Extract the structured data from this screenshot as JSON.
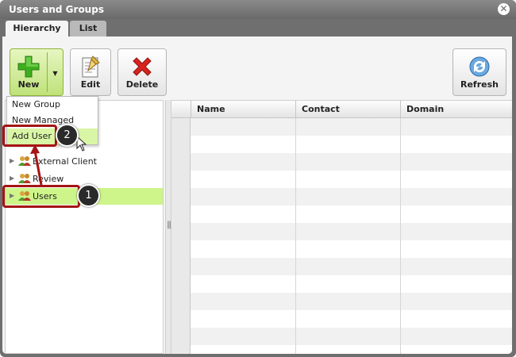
{
  "window": {
    "title": "Users and Groups",
    "close_glyph": "✕"
  },
  "tabs": [
    {
      "label": "Hierarchy",
      "active": true
    },
    {
      "label": "List",
      "active": false
    }
  ],
  "toolbar": {
    "new_label": "New",
    "edit_label": "Edit",
    "delete_label": "Delete",
    "refresh_label": "Refresh",
    "caret_glyph": "▼"
  },
  "new_menu": {
    "items": [
      "New Group",
      "New Managed Group",
      "Add User"
    ],
    "highlighted": "Add User"
  },
  "tree": {
    "items": [
      {
        "label": "External Client",
        "icon": "group-icon"
      },
      {
        "label": "Review",
        "icon": "group-icon"
      },
      {
        "label": "Users",
        "icon": "group-icon",
        "selected": true
      }
    ],
    "arrow_glyph": "▶"
  },
  "grid": {
    "columns": [
      "Name",
      "Contact",
      "Domain"
    ],
    "rows": []
  },
  "splitter": {
    "grip_glyph": "|||"
  },
  "callouts": [
    {
      "number": "1"
    },
    {
      "number": "2"
    }
  ],
  "colors": {
    "selected_row": "#cdf58a",
    "new_button": "#bfe27a",
    "callout_red": "#a51414",
    "titlebar": "#6f6f6f"
  }
}
